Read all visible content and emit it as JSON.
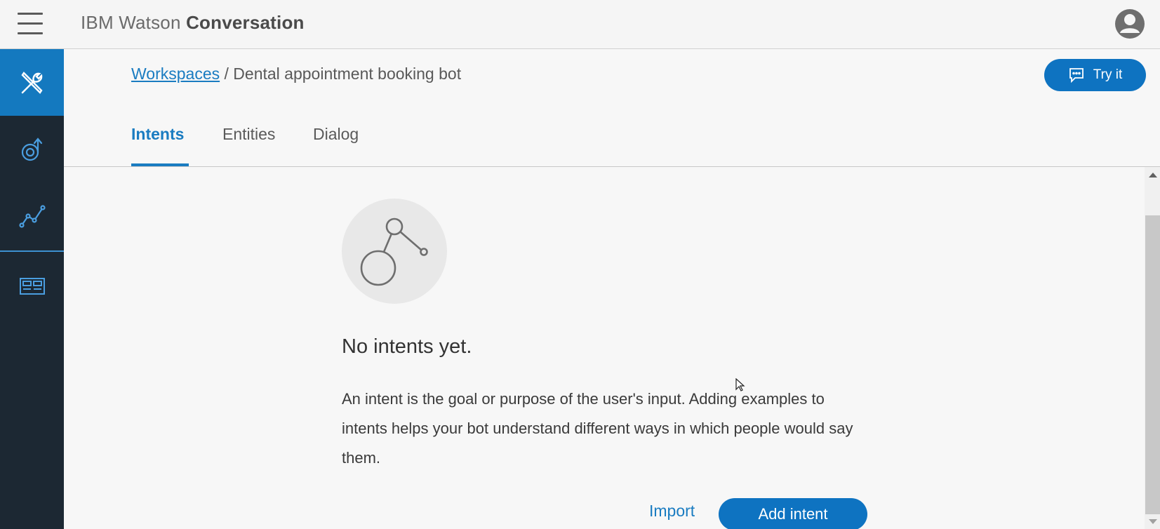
{
  "header": {
    "app_title_prefix": "IBM Watson",
    "app_title_bold": "Conversation",
    "menu_icon": "hamburger-menu-icon",
    "avatar_icon": "user-avatar-icon"
  },
  "rail": {
    "items": [
      {
        "icon": "tools-icon",
        "active": true
      },
      {
        "icon": "improve-icon",
        "active": false
      },
      {
        "icon": "analytics-icon",
        "active": false
      },
      {
        "icon": "deploy-icon",
        "active": false
      }
    ]
  },
  "breadcrumb": {
    "link": "Workspaces",
    "separator": "/",
    "current": "Dental appointment booking bot"
  },
  "try_button": {
    "label": "Try it",
    "icon": "chat-icon"
  },
  "tabs": [
    {
      "label": "Intents",
      "active": true
    },
    {
      "label": "Entities",
      "active": false
    },
    {
      "label": "Dialog",
      "active": false
    }
  ],
  "empty_state": {
    "icon": "intent-network-icon",
    "title": "No intents yet.",
    "description": "An intent is the goal or purpose of the user's input. Adding examples to intents helps your bot understand different ways in which people would say them.",
    "import_label": "Import",
    "add_label": "Add intent"
  },
  "colors": {
    "accent": "#0e73c1",
    "rail_bg": "#1c2833",
    "rail_active": "#1479bf",
    "page_bg": "#f7f7f7"
  }
}
